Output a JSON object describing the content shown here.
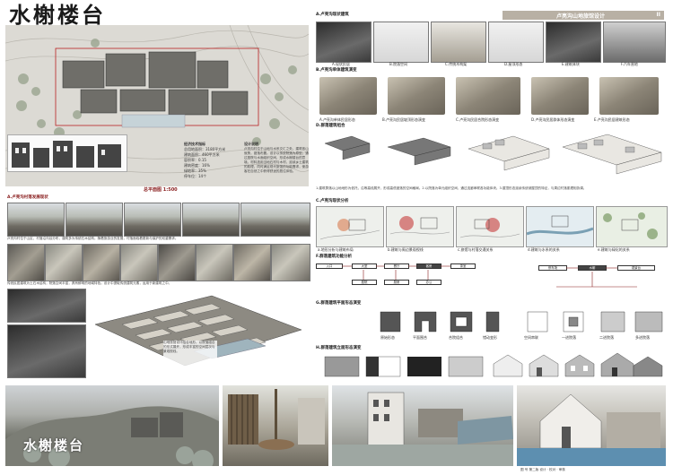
{
  "title": "水榭楼台",
  "banner": {
    "text": "卢亮沟山地旅馆设计",
    "page_no": "II"
  },
  "site_plan": {
    "info_title": "经济技术指标",
    "indicators": [
      "总用地面积：3180平方米",
      "建筑面积：460平方米",
      "容积率：0.15",
      "建筑密度：16%",
      "绿地率：35%",
      "停车位：14个"
    ],
    "concept_title": "设计说明",
    "concept_text": "卢亮沟村位于山地与水系交汇之处，建筑依山就势，错落布置。设计以传统院落为原型，通过庭院与水面组织空间，形成水榭楼台的意境。材料选用当地石材与木材，延续乡土建筑的肌理，同时满足现代旅馆的功能需求，使游客在自然之中获得舒适的居住体验。",
    "scale": "总平面图 1:500"
  },
  "headers": {
    "a": "A.卢亮沟现状建筑",
    "b": "B.卢亮沟单体建筑演变",
    "c": "C.卢亮沟现状分析",
    "d": "D.群落建筑组合",
    "e": "E.建筑形态生成",
    "f": "F.群落建筑功能分析",
    "g": "G.群落建筑平面形态演变",
    "h": "H.群落建筑立面形态演变",
    "left1": "A.卢亮沟村落发展现状",
    "left2": "B.卢亮沟建筑现状"
  },
  "photo_captions": [
    "A.现状民居",
    "B.院落空间",
    "C.传统木构架",
    "D.屋顶形态",
    "E.建筑体块",
    "F.汽车营地"
  ],
  "evolution_captions": [
    "A.卢亮沟单体民居形态",
    "B.卢亮沟民居坡顶形态演变",
    "C.卢亮沟民居合院形态演变",
    "D.卢亮沟民居群体形态演变",
    "E.卢亮沟民居建筑形态"
  ],
  "text_blocks": {
    "d_text": "1.建筑群落以山地地形为依托，沿等高线展开，形成高低错落的空间格局。2.以院落为单元组织空间，通过连廊串联各功能体块。3.屋顶形态延续传统坡屋顶的特征，与周边村落肌理相协调。",
    "left_text1": "卢亮沟村位于山区，村落沿沟谷分布，建筑多为传统石木结构。随着旅游业的发展，村落面临着更新与保护的双重需求。",
    "left_text2": "传统民居建筑为土石木结构，院落空间丰富，具有鲜明的地域特色。设计中提取传统建筑元素，运用于新建筑之中。",
    "left_text3": "山地旅馆设计结合地形，以院落组合的形式展开，形成丰富的空间层次与景观视线。"
  },
  "c_captions": [
    "a.地形分析与建筑布局",
    "b.建筑与周边景观视线",
    "c.旅馆与村落交通关系",
    "d.建筑与水系的关系",
    "e.建筑与绿化的关系"
  ],
  "f_labels": [
    "入口",
    "大堂",
    "餐厅",
    "客房",
    "茶室",
    "庭院",
    "厨房",
    "办公",
    "停车场",
    "水榭",
    "观景台"
  ],
  "g_labels": [
    "原始形态",
    "平面围合",
    "合院组合",
    "错动变形",
    "空间串联",
    "一进院落",
    "二进院落",
    "多进院落"
  ],
  "h_labels": [
    "原始形态",
    "坡顶变化",
    "体块加减",
    "立面开窗",
    "屋檐处理",
    "材质对比",
    "虚实变化",
    "最终立面"
  ],
  "bottom_sign": "水榭楼台",
  "footer": "图  号  第二版   设计  ·  校对  ·  审核",
  "colors": {
    "accent": "#8a1f1f",
    "banner": "#b8b0a4",
    "dark": "#3a3a3a"
  }
}
